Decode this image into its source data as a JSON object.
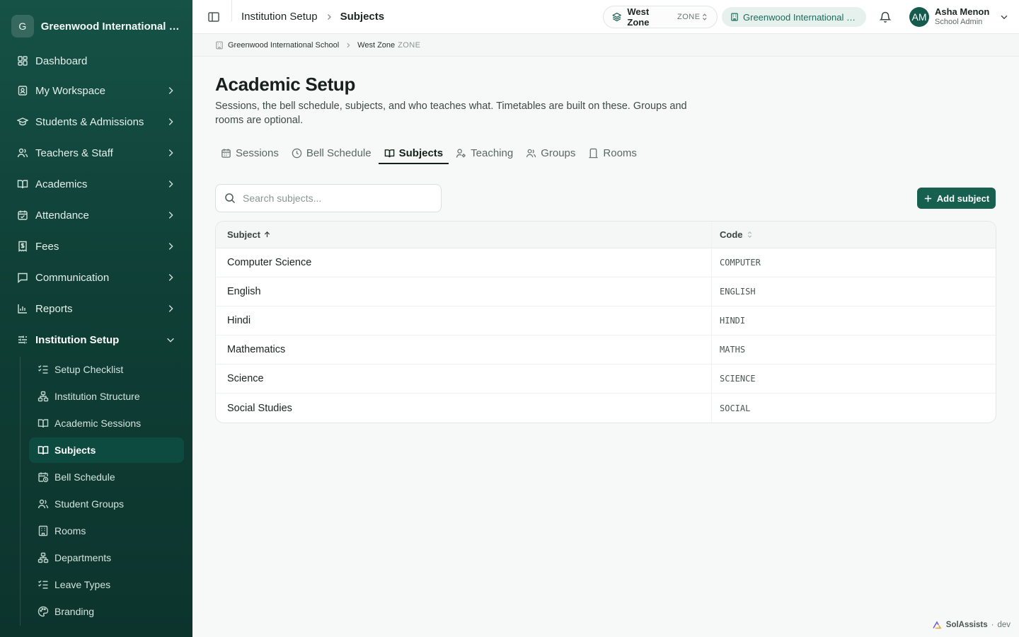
{
  "sidebar": {
    "brand_initial": "G",
    "brand_name": "Greenwood International School",
    "items": [
      {
        "label": "Dashboard"
      },
      {
        "label": "My Workspace"
      },
      {
        "label": "Students & Admissions"
      },
      {
        "label": "Teachers & Staff"
      },
      {
        "label": "Academics"
      },
      {
        "label": "Attendance"
      },
      {
        "label": "Fees"
      },
      {
        "label": "Communication"
      },
      {
        "label": "Reports"
      },
      {
        "label": "Institution Setup"
      }
    ],
    "sub_items": [
      {
        "label": "Setup Checklist"
      },
      {
        "label": "Institution Structure"
      },
      {
        "label": "Academic Sessions"
      },
      {
        "label": "Subjects"
      },
      {
        "label": "Bell Schedule"
      },
      {
        "label": "Student Groups"
      },
      {
        "label": "Rooms"
      },
      {
        "label": "Departments"
      },
      {
        "label": "Leave Types"
      },
      {
        "label": "Branding"
      }
    ]
  },
  "topbar": {
    "crumbs": [
      "Institution Setup",
      "Subjects"
    ],
    "zone_name": "West Zone",
    "zone_tag": "ZONE",
    "school_pill": "Greenwood International School",
    "user_initials": "AM",
    "user_name": "Asha Menon",
    "user_role": "School Admin"
  },
  "subbar": {
    "school": "Greenwood International School",
    "zone": "West Zone",
    "zone_tag": "ZONE"
  },
  "main": {
    "title": "Academic Setup",
    "description": "Sessions, the bell schedule, subjects, and who teaches what. Timetables are built on these. Groups and rooms are optional.",
    "tabs": [
      {
        "label": "Sessions"
      },
      {
        "label": "Bell Schedule"
      },
      {
        "label": "Subjects"
      },
      {
        "label": "Teaching"
      },
      {
        "label": "Groups"
      },
      {
        "label": "Rooms"
      }
    ],
    "search_placeholder": "Search subjects...",
    "add_label": "Add subject",
    "table": {
      "headers": {
        "subject": "Subject",
        "code": "Code"
      },
      "rows": [
        {
          "subject": "Computer Science",
          "code": "COMPUTER"
        },
        {
          "subject": "English",
          "code": "ENGLISH"
        },
        {
          "subject": "Hindi",
          "code": "HINDI"
        },
        {
          "subject": "Mathematics",
          "code": "MATHS"
        },
        {
          "subject": "Science",
          "code": "SCIENCE"
        },
        {
          "subject": "Social Studies",
          "code": "SOCIAL"
        }
      ]
    }
  },
  "footer": {
    "brand": "SolAssists",
    "sep": "·",
    "env": "dev"
  },
  "colors": {
    "sidebar": "#165246",
    "accent": "#17604f",
    "pill_bg": "#e6f1ed"
  }
}
